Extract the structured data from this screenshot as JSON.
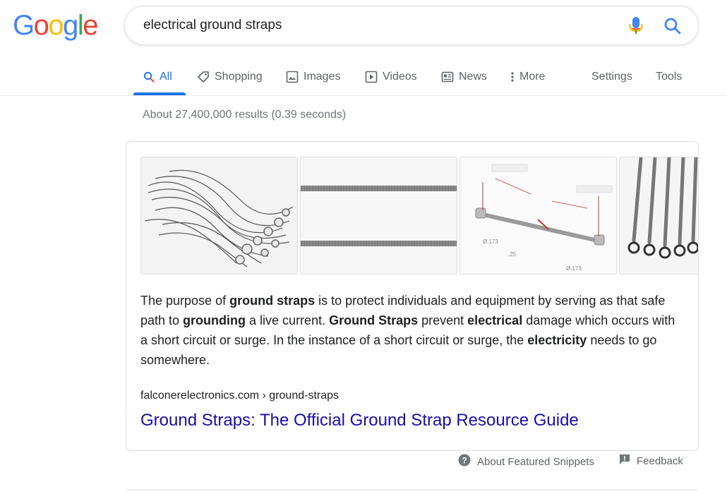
{
  "logo": {
    "letters": [
      "G",
      "o",
      "o",
      "g",
      "l",
      "e"
    ],
    "colors": [
      "#4285f4",
      "#ea4335",
      "#fbbc05",
      "#4285f4",
      "#34a853",
      "#ea4335"
    ]
  },
  "search": {
    "query": "electrical ground straps",
    "icons": [
      "mic-icon",
      "search-icon"
    ]
  },
  "tabs": [
    {
      "label": "All",
      "icon": "search-icon",
      "active": true
    },
    {
      "label": "Shopping",
      "icon": "tag-icon"
    },
    {
      "label": "Images",
      "icon": "image-icon"
    },
    {
      "label": "Videos",
      "icon": "play-icon"
    },
    {
      "label": "News",
      "icon": "newspaper-icon"
    },
    {
      "label": "More",
      "icon": "more-vert-icon"
    }
  ],
  "tools": {
    "settings": "Settings",
    "tools": "Tools"
  },
  "stats": "About 27,400,000 results (0.39 seconds)",
  "snippet": {
    "images": [
      "bundle-of-braided-straps",
      "two-braided-straps",
      "strap-dimension-diagram",
      "hanging-straps-with-rings"
    ],
    "text_parts": [
      {
        "t": "The purpose of ",
        "b": false
      },
      {
        "t": "ground straps",
        "b": true
      },
      {
        "t": " is to protect individuals and equipment by serving as that safe path to ",
        "b": false
      },
      {
        "t": "grounding",
        "b": true
      },
      {
        "t": " a live current. ",
        "b": false
      },
      {
        "t": "Ground Straps",
        "b": true
      },
      {
        "t": " prevent ",
        "b": false
      },
      {
        "t": "electrical",
        "b": true
      },
      {
        "t": " damage which occurs with a short circuit or surge. In the instance of a short circuit or surge, the ",
        "b": false
      },
      {
        "t": "electricity",
        "b": true
      },
      {
        "t": " needs to go somewhere.",
        "b": false
      }
    ],
    "cite": "falconerelectronics.com › ground-straps",
    "title": "Ground Straps: The Official Ground Strap Resource Guide",
    "diagram_labels": [
      "Ø.173",
      ".25",
      "Ø.173"
    ]
  },
  "footer": {
    "about": "About Featured Snippets",
    "feedback": "Feedback"
  }
}
